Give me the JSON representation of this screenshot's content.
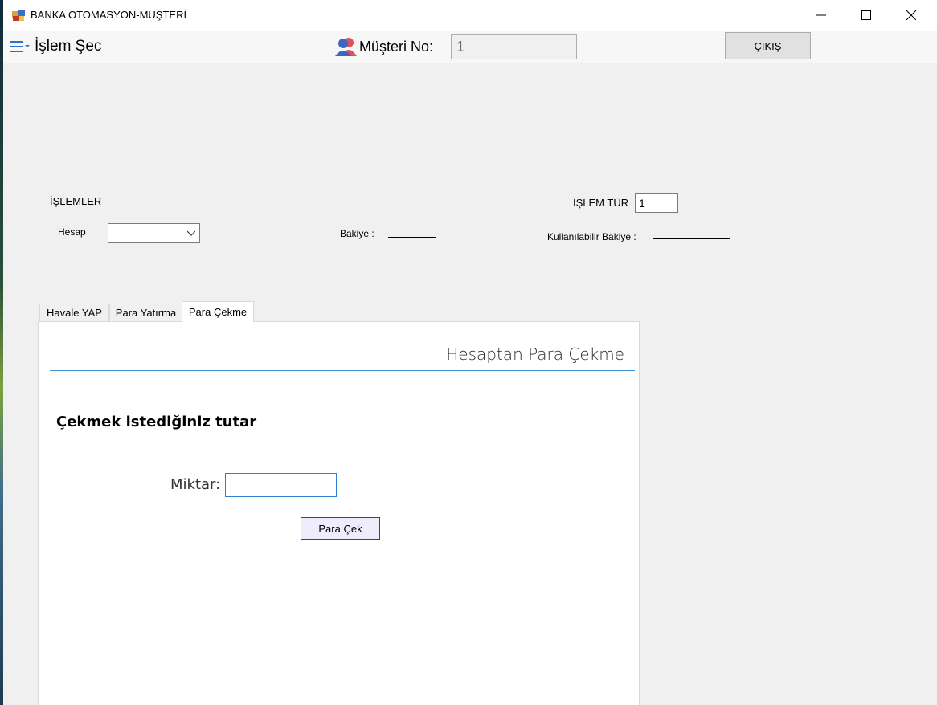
{
  "window": {
    "title": "BANKA OTOMASYON-MÜŞTERİ"
  },
  "menubar": {
    "menu_label": "İşlem Şec",
    "musteri_label": "Müşteri No:",
    "musteri_value": "1",
    "cikis_label": "ÇIKIŞ"
  },
  "form": {
    "islemler_label": "İŞLEMLER",
    "hesap_label": "Hesap",
    "hesap_value": "",
    "bakiye_label": "Bakiye :",
    "islem_tur_label": "İŞLEM TÜR",
    "islem_tur_value": "1",
    "kullanilabilir_label": "Kullanılabilir Bakiye :"
  },
  "tabs": [
    {
      "label": "Havale YAP",
      "active": false
    },
    {
      "label": "Para Yatırma",
      "active": false
    },
    {
      "label": "Para Çekme",
      "active": true
    }
  ],
  "panel": {
    "title": "Hesaptan Para Çekme",
    "heading": "Çekmek istediğiniz tutar",
    "miktar_label": "Miktar:",
    "miktar_value": "",
    "button_label": "Para Çek"
  },
  "icons": {
    "app": "bank-app-icon",
    "menu": "hamburger-menu-icon",
    "user": "users-icon",
    "minimize": "minimize-icon",
    "maximize": "maximize-icon",
    "close": "close-icon",
    "dropdown": "chevron-down-icon"
  },
  "colors": {
    "accent_line": "#3c8fd1",
    "button_border": "#3b3b8f",
    "menu_icon": "#2f6fc7"
  }
}
